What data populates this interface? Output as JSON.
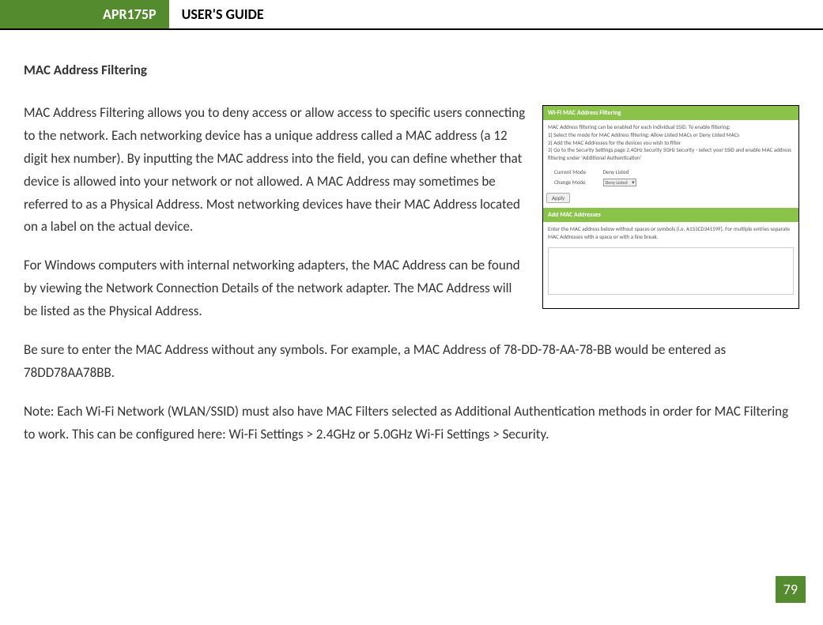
{
  "header": {
    "model": "APR175P",
    "title": "USER'S GUIDE"
  },
  "section_title": "MAC Address Filtering",
  "paragraphs": {
    "p1": "MAC Address Filtering allows you to deny access or allow access to specific users connecting to the network. Each networking device has a unique address called a MAC address (a 12 digit hex number). By inputting the MAC address into the field, you can define whether that device is allowed into your network or not allowed. A MAC Address may sometimes be referred to as a Physical Address. Most networking devices have their MAC Address located on a label on the actual device.",
    "p2": "For Windows computers with internal networking adapters, the MAC Address can be found by viewing the Network Connection Details of the network adapter. The MAC Address will be listed as the Physical Address.",
    "p3": "Be sure to enter the MAC Address without any symbols. For example, a MAC Address of 78-DD-78-AA-78-BB would be entered as 78DD78AA78BB.",
    "p4": "Note: Each Wi-Fi Network (WLAN/SSID) must also have MAC Filters selected as Additional Authentication methods in order for MAC Filtering to work. This can be configured here: Wi-Fi Settings > 2.4GHz or 5.0GHz Wi-Fi Settings > Security."
  },
  "screenshot": {
    "bar1": "Wi-Fi MAC Address Filtering",
    "intro": "MAC Address filtering can be enabled for each individual SSID. To enable filtering:",
    "step1": "1) Select the mode for MAC Address filtering: Allow Listed MACs or Deny Listed MACs",
    "step2": "2) Add the MAC Addresses for the devices you wish to filter",
    "step3": "3) Go to the Security Settings page 2.4GHz Security  5GHz Security - select your SSID and enable MAC address filtering under 'Additional Authentication'",
    "current_mode_label": "Current Mode",
    "current_mode_value": "Deny Listed",
    "change_mode_label": "Change Mode",
    "change_mode_value": "Deny Listed",
    "apply": "Apply",
    "bar2": "Add MAC Addresses",
    "add_text": "Enter the MAC address below without spaces or symbols (i.e. A153CD34159F). For multiple entries separate MAC Addresses with a space or with a line break."
  },
  "page_number": "79"
}
